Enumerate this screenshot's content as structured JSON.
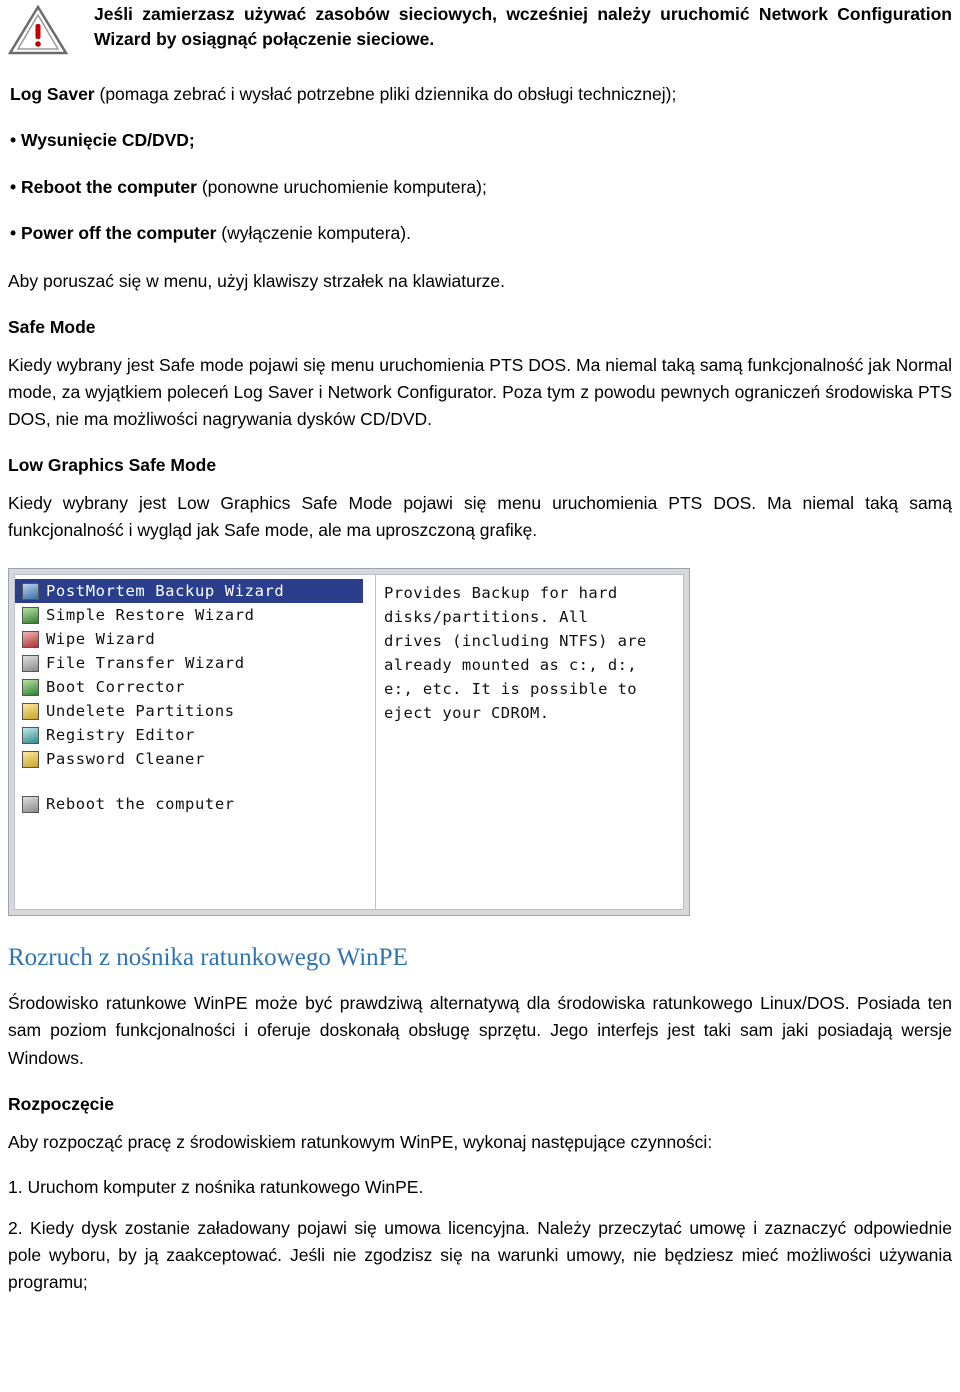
{
  "note": {
    "icon": "warning-triangle-icon",
    "text": "Jeśli zamierzasz używać zasobów sieciowych, wcześniej należy uruchomić Network Configuration Wizard by osiągnąć połączenie sieciowe."
  },
  "bullets": [
    {
      "bold": "Log Saver",
      "rest": " (pomaga zebrać i wysłać potrzebne pliki dziennika do obsługi technicznej);"
    },
    {
      "bold": "• Wysunięcie CD/DVD;",
      "rest": ""
    },
    {
      "bold": "• Reboot the computer",
      "rest": " (ponowne uruchomienie komputera);"
    },
    {
      "bold": "• Power off the computer",
      "rest": " (wyłączenie komputera)."
    }
  ],
  "paragraphs": {
    "arrows": "Aby poruszać się w menu, użyj klawiszy strzałek na klawiaturze.",
    "safe_mode_head": "Safe Mode",
    "safe_mode_body": "Kiedy wybrany jest   Safe mode   pojawi się menu uruchomienia PTS DOS. Ma niemal taką samą funkcjonalność jak Normal mode, za wyjątkiem poleceń Log Saver i Network Configurator. Poza tym z powodu pewnych ograniczeń środowiska PTS DOS, nie ma możliwości nagrywania dysków CD/DVD.",
    "low_graphics_head": "Low Graphics Safe Mode",
    "low_graphics_body": "Kiedy wybrany jest   Low Graphics Safe Mode   pojawi się menu uruchomienia PTS DOS. Ma niemal taką samą funkcjonalność i wygląd jak  Safe mode, ale ma uproszczoną grafikę."
  },
  "screenshot": {
    "menu_items": [
      {
        "label": "PostMortem Backup Wizard",
        "icon": "floppy-disk-icon",
        "selected": true
      },
      {
        "label": "Simple Restore Wizard",
        "icon": "restore-icon",
        "selected": false
      },
      {
        "label": "Wipe Wizard",
        "icon": "wipe-icon",
        "selected": false
      },
      {
        "label": "File Transfer Wizard",
        "icon": "file-transfer-icon",
        "selected": false
      },
      {
        "label": "Boot Corrector",
        "icon": "boot-corrector-icon",
        "selected": false
      },
      {
        "label": "Undelete Partitions",
        "icon": "undelete-icon",
        "selected": false
      },
      {
        "label": "Registry Editor",
        "icon": "registry-icon",
        "selected": false
      },
      {
        "label": "Password Cleaner",
        "icon": "password-icon",
        "selected": false
      }
    ],
    "menu_footer": {
      "label": "Reboot the computer",
      "icon": "reboot-icon"
    },
    "description_lines": [
      "Provides Backup for hard",
      "disks/partitions. All",
      "drives (including NTFS) are",
      "already mounted as c:, d:,",
      "e:, etc. It is possible to",
      "eject your CDROM."
    ]
  },
  "section": {
    "title": "Rozruch z nośnika ratunkowego WinPE",
    "intro": "Środowisko ratunkowe WinPE może być prawdziwą alternatywą dla środowiska ratunkowego Linux/DOS. Posiada ten sam poziom funkcjonalności i oferuje doskonałą obsługę sprzętu. Jego interfejs jest taki sam jaki posiadają wersje Windows.",
    "start_head": "Rozpoczęcie",
    "start_body": "Aby rozpocząć pracę z środowiskiem ratunkowym WinPE, wykonaj następujące czynności:",
    "steps": [
      "1. Uruchom komputer z nośnika ratunkowego WinPE.",
      "2. Kiedy dysk zostanie załadowany pojawi się   umowa licencyjna. Należy przeczytać umowę i zaznaczyć odpowiednie pole wyboru, by ją zaakceptować. Jeśli nie zgodzisz się na warunki umowy, nie będziesz mieć możliwości używania programu;"
    ]
  },
  "colors": {
    "heading": "#2e74b5",
    "menu_selected_bg": "#2b3e8c",
    "warning": "#c00000"
  }
}
